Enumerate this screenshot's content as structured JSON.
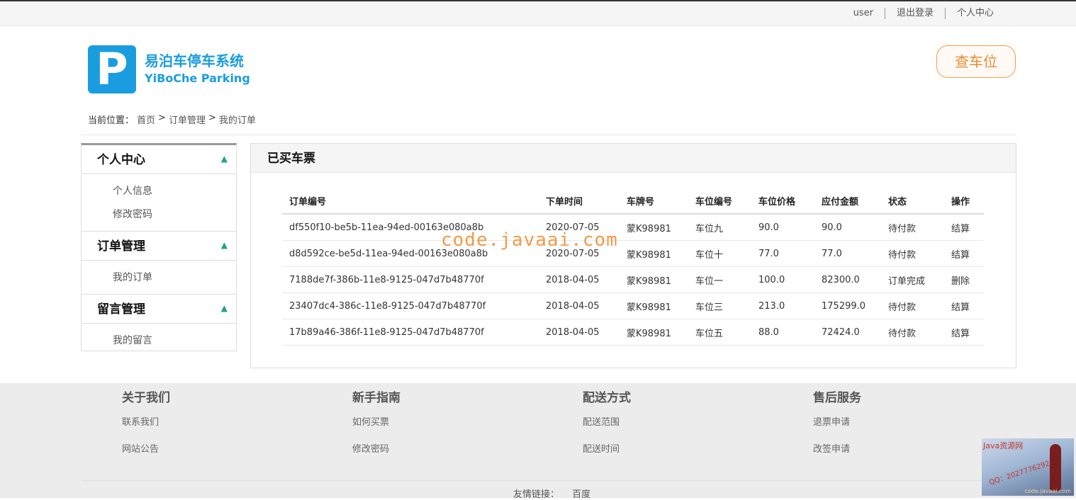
{
  "topbar": {
    "username": "user",
    "logout": "退出登录",
    "personal_center": "个人中心"
  },
  "logo": {
    "letter": "P",
    "name_cn": "易泊车停车系统",
    "name_en": "YiBoChe  Parking"
  },
  "header": {
    "find_spot_button": "查车位"
  },
  "breadcrumb": {
    "prefix": "当前位置：",
    "home": "首页",
    "sep": ">",
    "section": "订单管理",
    "current": "我的订单"
  },
  "sidebar": {
    "groups": [
      {
        "title": "个人中心",
        "items": [
          "个人信息",
          "修改密码"
        ]
      },
      {
        "title": "订单管理",
        "items": [
          "我的订单"
        ]
      },
      {
        "title": "留言管理",
        "items": [
          "我的留言"
        ]
      }
    ],
    "chevron": "^"
  },
  "panel": {
    "title": "已买车票"
  },
  "table": {
    "headers": [
      "订单编号",
      "下单时间",
      "车牌号",
      "车位编号",
      "车位价格",
      "应付金额",
      "状态",
      "操作"
    ],
    "rows": [
      [
        "df550f10-be5b-11ea-94ed-00163e080a8b",
        "2020-07-05",
        "蒙K98981",
        "车位九",
        "90.0",
        "90.0",
        "待付款",
        "结算"
      ],
      [
        "d8d592ce-be5d-11ea-94ed-00163e080a8b",
        "2020-07-05",
        "蒙K98981",
        "车位十",
        "77.0",
        "77.0",
        "待付款",
        "结算"
      ],
      [
        "7188de7f-386b-11e8-9125-047d7b48770f",
        "2018-04-05",
        "蒙K98981",
        "车位一",
        "100.0",
        "82300.0",
        "订单完成",
        "删除"
      ],
      [
        "23407dc4-386c-11e8-9125-047d7b48770f",
        "2018-04-05",
        "蒙K98981",
        "车位三",
        "213.0",
        "175299.0",
        "待付款",
        "结算"
      ],
      [
        "17b89a46-386f-11e8-9125-047d7b48770f",
        "2018-04-05",
        "蒙K98981",
        "车位五",
        "88.0",
        "72424.0",
        "待付款",
        "结算"
      ]
    ]
  },
  "watermark": "code.javaai.com",
  "footer": {
    "columns": [
      {
        "title": "关于我们",
        "links": [
          "联系我们",
          "网站公告"
        ]
      },
      {
        "title": "新手指南",
        "links": [
          "如何买票",
          "修改密码"
        ]
      },
      {
        "title": "配送方式",
        "links": [
          "配送范围",
          "配送时间"
        ]
      },
      {
        "title": "售后服务",
        "links": [
          "退票申请",
          "改签申请"
        ]
      }
    ],
    "friend_links_label": "友情链接：",
    "friend_links": [
      "百度"
    ]
  },
  "promo": {
    "title": "Java资源网",
    "qq": "QQ：2027776292",
    "site": "code.javaai.com"
  },
  "colors": {
    "brand_blue": "#1a9de0",
    "accent_orange": "#ec8a2e",
    "status_pending": "#c0392b",
    "status_done": "#2e8b2e",
    "chevron_teal": "#20a090"
  }
}
